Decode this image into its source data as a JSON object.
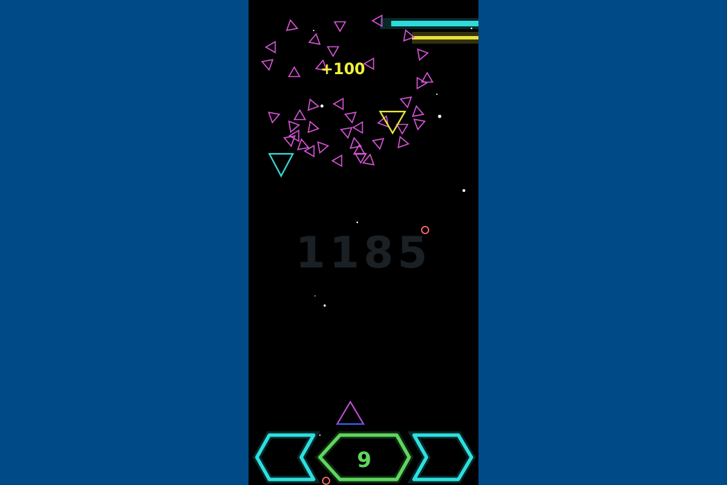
{
  "game": {
    "score": "1185",
    "bonus_popup": "+100",
    "level": "9"
  },
  "controls": {
    "left_label": "move-left",
    "right_label": "move-right"
  },
  "colors": {
    "frame_bg": "#004a87",
    "field_bg": "#000000",
    "enemy": "#d855d8",
    "bonus_enemy": "#e8e83a",
    "ice_enemy": "#37d6d6",
    "score": "#1b2024",
    "popup": "#f1f138",
    "arrow_button": "#2fe0e0",
    "level_button": "#5fd65f",
    "player_ship": "#c44fd6",
    "laser_cyan": "#30e6e6",
    "laser_yellow": "#e8e03a"
  }
}
